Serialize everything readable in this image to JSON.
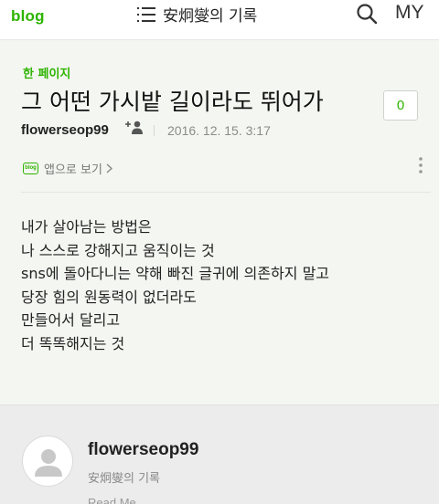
{
  "header": {
    "logo": "blog",
    "menu_icon": "hamburger-menu-icon",
    "blog_title": "安炯燮의 기록",
    "search_icon": "search-icon",
    "my_label": "MY"
  },
  "post": {
    "category": "한 페이지",
    "title": "그 어떤 가시밭 길이라도 뛰어가",
    "comment_count": "0",
    "author": "flowerseop99",
    "date": "2016. 12. 15. 3:17",
    "app_link_label": "앱으로 보기",
    "app_icon_text": "blog",
    "content_lines": [
      "내가 살아남는 방법은",
      "나 스스로 강해지고 움직이는 것",
      "sns에 돌아다니는 약해 빠진 글귀에 의존하지 말고",
      "당장 힘의 원동력이 없더라도",
      "만들어서 달리고",
      "더 똑똑해지는 것"
    ]
  },
  "profile": {
    "name": "flowerseop99",
    "blog_name": "安炯燮의 기록",
    "more_text": "Read Me"
  },
  "colors": {
    "brand_green": "#2db400",
    "background": "#f4f6f1",
    "profile_bg": "#ececec"
  }
}
